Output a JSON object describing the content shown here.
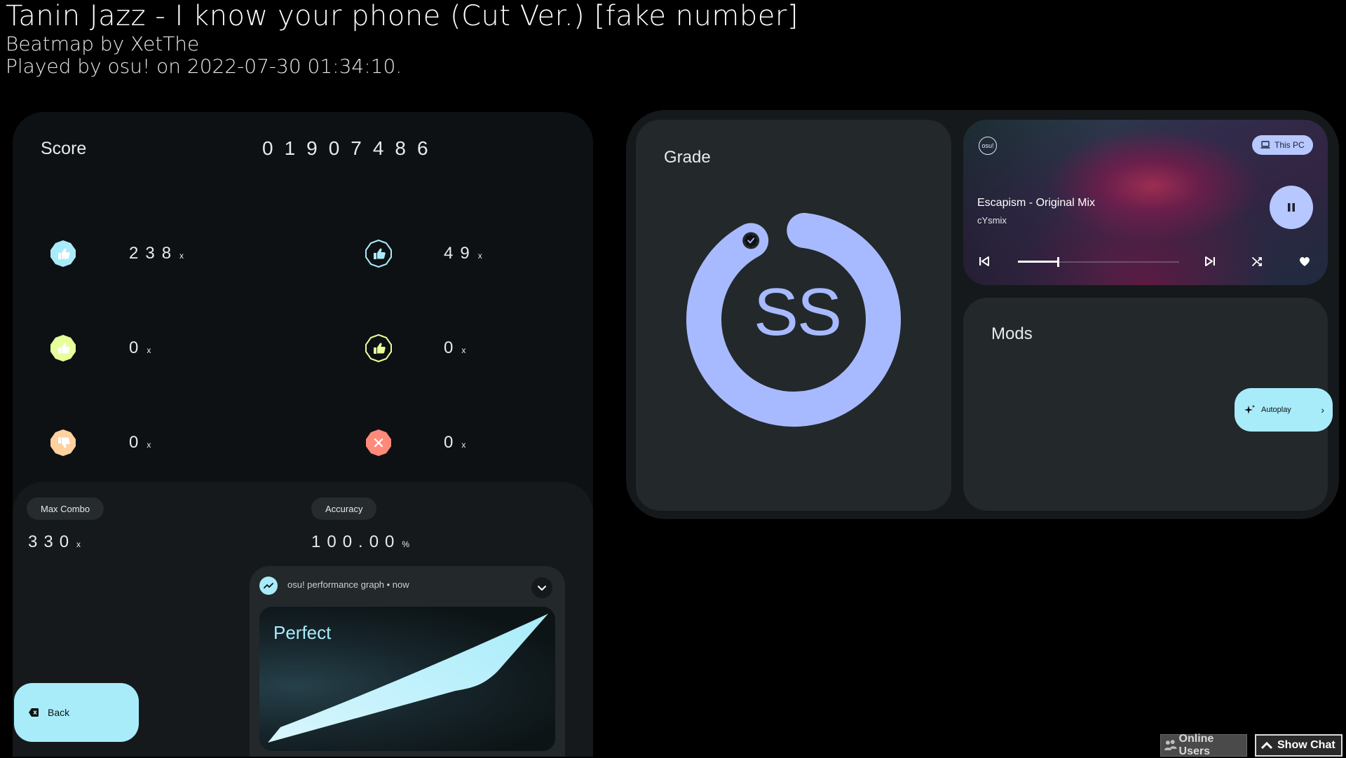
{
  "header": {
    "title": "Tanin Jazz - I know your phone (Cut Ver.) [fake number]",
    "beatmap_by": "Beatmap by XetThe",
    "played_by": "Played by osu! on 2022-07-30 01:34:10."
  },
  "score": {
    "label": "Score",
    "value": "01907486"
  },
  "hits": [
    {
      "name": "great",
      "count": "238",
      "suffix": "x",
      "color": "#a8ecfa"
    },
    {
      "name": "ok",
      "count": "49",
      "suffix": "x",
      "color": "#a8ecfa"
    },
    {
      "name": "good",
      "count": "0",
      "suffix": "x",
      "color": "#e6ff9a"
    },
    {
      "name": "meh",
      "count": "0",
      "suffix": "x",
      "color": "#e6ff9a"
    },
    {
      "name": "bad",
      "count": "0",
      "suffix": "x",
      "color": "#ffd19e"
    },
    {
      "name": "miss",
      "count": "0",
      "suffix": "x",
      "color": "#ff8a7a"
    }
  ],
  "stats": {
    "max_combo_label": "Max Combo",
    "max_combo_value": "330",
    "max_combo_suffix": "x",
    "accuracy_label": "Accuracy",
    "accuracy_value": "100.00",
    "accuracy_suffix": "%"
  },
  "notification": {
    "app_name": "osu! performance graph • now",
    "graph_title": "Perfect"
  },
  "back_button": {
    "label": "Back"
  },
  "grade": {
    "label": "Grade",
    "letter": "SS",
    "progress": 0.93,
    "accent": "#a8baff"
  },
  "media": {
    "app_icon_text": "osu!",
    "device_label": "This PC",
    "track_title": "Escapism - Original Mix",
    "artist": "cYsmix",
    "seek_position": 0.25
  },
  "mods": {
    "label": "Mods",
    "mod_name": "Autoplay"
  },
  "footer": {
    "online_users": "Online Users",
    "show_chat": "Show Chat"
  },
  "colors": {
    "accent_cyan": "#a8ecfa",
    "accent_periwinkle": "#a8baff",
    "panel_dark": "#15191b",
    "card": "#23282b"
  }
}
